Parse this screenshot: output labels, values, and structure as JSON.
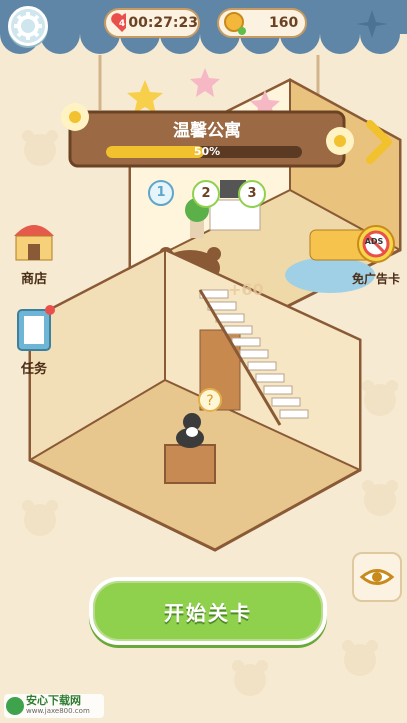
{
  "hud": {
    "timer": "00:27:23",
    "coins": "160"
  },
  "banner": {
    "title": "温馨公寓",
    "progress_text": "50%",
    "progress_value": 0.5
  },
  "steps": [
    "1",
    "2",
    "3"
  ],
  "side": {
    "shop_label": "商店",
    "tasks_label": "任务",
    "adfree_label": "免广告卡",
    "adfree_badge": "ADS"
  },
  "float_text": "+60",
  "start_button": "开始关卡",
  "watermark": {
    "name": "安心下载网",
    "url": "www.jaxe800.com"
  },
  "colors": {
    "accent_green": "#8fd14d",
    "progress_fill": "#f2c12e",
    "banner_wood": "#9b6a44"
  }
}
